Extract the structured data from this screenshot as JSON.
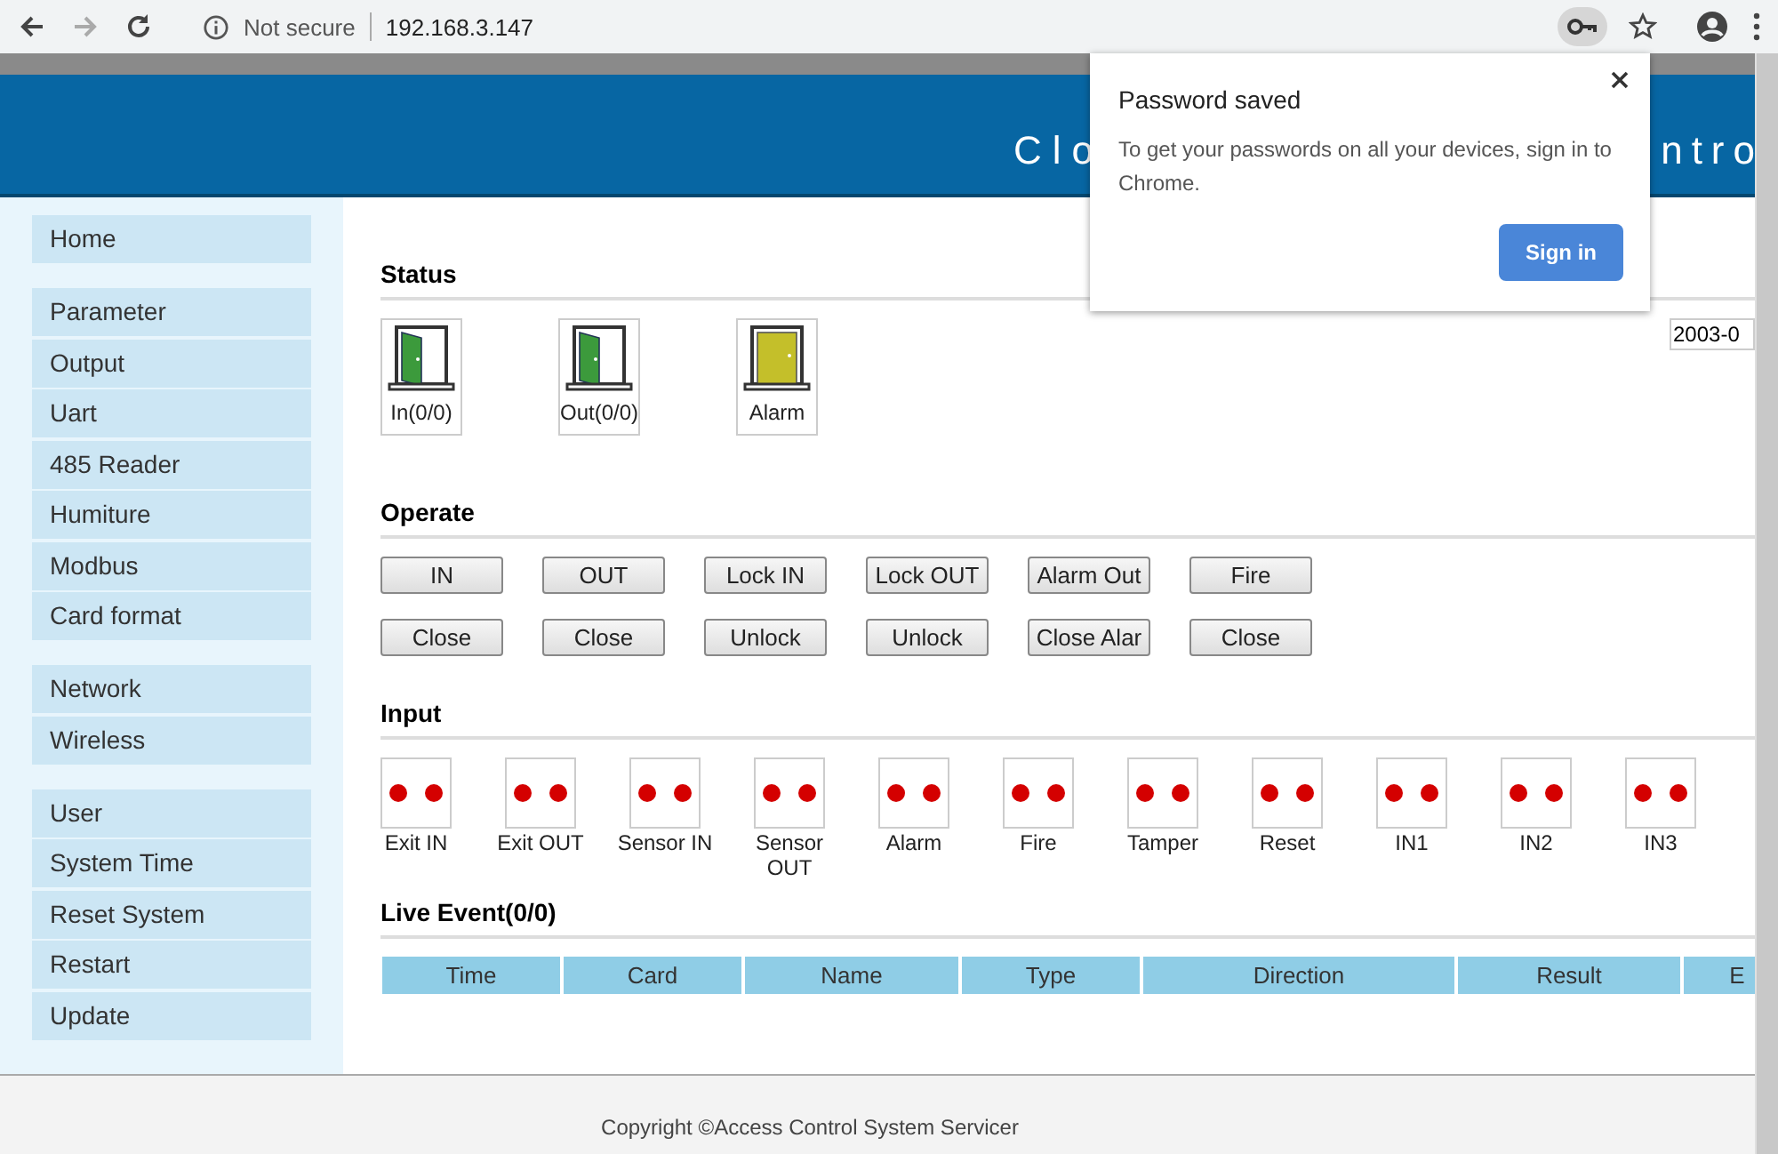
{
  "browser": {
    "security_label": "Not secure",
    "address": "192.168.3.147"
  },
  "header": {
    "title_left": "Clo",
    "title_right": "ntro"
  },
  "sidebar": {
    "groups": [
      {
        "items": [
          {
            "label": "Home"
          }
        ]
      },
      {
        "items": [
          {
            "label": "Parameter"
          },
          {
            "label": "Output"
          },
          {
            "label": "Uart"
          },
          {
            "label": "485 Reader"
          },
          {
            "label": "Humiture"
          },
          {
            "label": "Modbus"
          },
          {
            "label": "Card format"
          }
        ]
      },
      {
        "items": [
          {
            "label": "Network"
          },
          {
            "label": "Wireless"
          }
        ]
      },
      {
        "items": [
          {
            "label": "User"
          },
          {
            "label": "System Time"
          },
          {
            "label": "Reset System"
          },
          {
            "label": "Restart"
          },
          {
            "label": "Update"
          }
        ]
      }
    ]
  },
  "status": {
    "heading": "Status",
    "date": "2003-0",
    "doors": [
      {
        "label": "In(0/0)",
        "kind": "open",
        "color": "#3c9a3c"
      },
      {
        "label": "Out(0/0)",
        "kind": "open",
        "color": "#3c9a3c"
      },
      {
        "label": "Alarm",
        "kind": "closed",
        "color": "#c4bf2a"
      }
    ]
  },
  "operate": {
    "heading": "Operate",
    "rows": [
      [
        "IN",
        "OUT",
        "Lock IN",
        "Lock OUT",
        "Alarm Out",
        "Fire"
      ],
      [
        "Close",
        "Close",
        "Unlock",
        "Unlock",
        "Close Alar",
        "Close"
      ]
    ]
  },
  "input": {
    "heading": "Input",
    "items": [
      {
        "label": "Exit IN"
      },
      {
        "label": "Exit OUT"
      },
      {
        "label": "Sensor IN"
      },
      {
        "label": "Sensor OUT"
      },
      {
        "label": "Alarm"
      },
      {
        "label": "Fire"
      },
      {
        "label": "Tamper"
      },
      {
        "label": "Reset"
      },
      {
        "label": "IN1"
      },
      {
        "label": "IN2"
      },
      {
        "label": "IN3"
      }
    ]
  },
  "live_event": {
    "heading": "Live Event(0/0)",
    "columns": [
      "Time",
      "Card",
      "Name",
      "Type",
      "Direction",
      "Result",
      "E"
    ]
  },
  "footer": {
    "copyright": "Copyright ©Access Control System Servicer"
  },
  "popup": {
    "title": "Password saved",
    "message": "To get your passwords on all your devices, sign in to Chrome.",
    "button": "Sign in"
  }
}
